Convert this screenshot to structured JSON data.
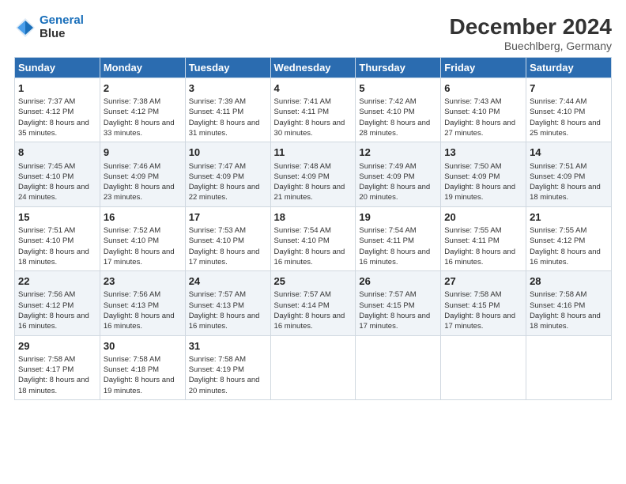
{
  "header": {
    "logo_line1": "General",
    "logo_line2": "Blue",
    "title": "December 2024",
    "subtitle": "Buechlberg, Germany"
  },
  "days_of_week": [
    "Sunday",
    "Monday",
    "Tuesday",
    "Wednesday",
    "Thursday",
    "Friday",
    "Saturday"
  ],
  "weeks": [
    [
      {
        "day": "1",
        "sunrise": "Sunrise: 7:37 AM",
        "sunset": "Sunset: 4:12 PM",
        "daylight": "Daylight: 8 hours and 35 minutes."
      },
      {
        "day": "2",
        "sunrise": "Sunrise: 7:38 AM",
        "sunset": "Sunset: 4:12 PM",
        "daylight": "Daylight: 8 hours and 33 minutes."
      },
      {
        "day": "3",
        "sunrise": "Sunrise: 7:39 AM",
        "sunset": "Sunset: 4:11 PM",
        "daylight": "Daylight: 8 hours and 31 minutes."
      },
      {
        "day": "4",
        "sunrise": "Sunrise: 7:41 AM",
        "sunset": "Sunset: 4:11 PM",
        "daylight": "Daylight: 8 hours and 30 minutes."
      },
      {
        "day": "5",
        "sunrise": "Sunrise: 7:42 AM",
        "sunset": "Sunset: 4:10 PM",
        "daylight": "Daylight: 8 hours and 28 minutes."
      },
      {
        "day": "6",
        "sunrise": "Sunrise: 7:43 AM",
        "sunset": "Sunset: 4:10 PM",
        "daylight": "Daylight: 8 hours and 27 minutes."
      },
      {
        "day": "7",
        "sunrise": "Sunrise: 7:44 AM",
        "sunset": "Sunset: 4:10 PM",
        "daylight": "Daylight: 8 hours and 25 minutes."
      }
    ],
    [
      {
        "day": "8",
        "sunrise": "Sunrise: 7:45 AM",
        "sunset": "Sunset: 4:10 PM",
        "daylight": "Daylight: 8 hours and 24 minutes."
      },
      {
        "day": "9",
        "sunrise": "Sunrise: 7:46 AM",
        "sunset": "Sunset: 4:09 PM",
        "daylight": "Daylight: 8 hours and 23 minutes."
      },
      {
        "day": "10",
        "sunrise": "Sunrise: 7:47 AM",
        "sunset": "Sunset: 4:09 PM",
        "daylight": "Daylight: 8 hours and 22 minutes."
      },
      {
        "day": "11",
        "sunrise": "Sunrise: 7:48 AM",
        "sunset": "Sunset: 4:09 PM",
        "daylight": "Daylight: 8 hours and 21 minutes."
      },
      {
        "day": "12",
        "sunrise": "Sunrise: 7:49 AM",
        "sunset": "Sunset: 4:09 PM",
        "daylight": "Daylight: 8 hours and 20 minutes."
      },
      {
        "day": "13",
        "sunrise": "Sunrise: 7:50 AM",
        "sunset": "Sunset: 4:09 PM",
        "daylight": "Daylight: 8 hours and 19 minutes."
      },
      {
        "day": "14",
        "sunrise": "Sunrise: 7:51 AM",
        "sunset": "Sunset: 4:09 PM",
        "daylight": "Daylight: 8 hours and 18 minutes."
      }
    ],
    [
      {
        "day": "15",
        "sunrise": "Sunrise: 7:51 AM",
        "sunset": "Sunset: 4:10 PM",
        "daylight": "Daylight: 8 hours and 18 minutes."
      },
      {
        "day": "16",
        "sunrise": "Sunrise: 7:52 AM",
        "sunset": "Sunset: 4:10 PM",
        "daylight": "Daylight: 8 hours and 17 minutes."
      },
      {
        "day": "17",
        "sunrise": "Sunrise: 7:53 AM",
        "sunset": "Sunset: 4:10 PM",
        "daylight": "Daylight: 8 hours and 17 minutes."
      },
      {
        "day": "18",
        "sunrise": "Sunrise: 7:54 AM",
        "sunset": "Sunset: 4:10 PM",
        "daylight": "Daylight: 8 hours and 16 minutes."
      },
      {
        "day": "19",
        "sunrise": "Sunrise: 7:54 AM",
        "sunset": "Sunset: 4:11 PM",
        "daylight": "Daylight: 8 hours and 16 minutes."
      },
      {
        "day": "20",
        "sunrise": "Sunrise: 7:55 AM",
        "sunset": "Sunset: 4:11 PM",
        "daylight": "Daylight: 8 hours and 16 minutes."
      },
      {
        "day": "21",
        "sunrise": "Sunrise: 7:55 AM",
        "sunset": "Sunset: 4:12 PM",
        "daylight": "Daylight: 8 hours and 16 minutes."
      }
    ],
    [
      {
        "day": "22",
        "sunrise": "Sunrise: 7:56 AM",
        "sunset": "Sunset: 4:12 PM",
        "daylight": "Daylight: 8 hours and 16 minutes."
      },
      {
        "day": "23",
        "sunrise": "Sunrise: 7:56 AM",
        "sunset": "Sunset: 4:13 PM",
        "daylight": "Daylight: 8 hours and 16 minutes."
      },
      {
        "day": "24",
        "sunrise": "Sunrise: 7:57 AM",
        "sunset": "Sunset: 4:13 PM",
        "daylight": "Daylight: 8 hours and 16 minutes."
      },
      {
        "day": "25",
        "sunrise": "Sunrise: 7:57 AM",
        "sunset": "Sunset: 4:14 PM",
        "daylight": "Daylight: 8 hours and 16 minutes."
      },
      {
        "day": "26",
        "sunrise": "Sunrise: 7:57 AM",
        "sunset": "Sunset: 4:15 PM",
        "daylight": "Daylight: 8 hours and 17 minutes."
      },
      {
        "day": "27",
        "sunrise": "Sunrise: 7:58 AM",
        "sunset": "Sunset: 4:15 PM",
        "daylight": "Daylight: 8 hours and 17 minutes."
      },
      {
        "day": "28",
        "sunrise": "Sunrise: 7:58 AM",
        "sunset": "Sunset: 4:16 PM",
        "daylight": "Daylight: 8 hours and 18 minutes."
      }
    ],
    [
      {
        "day": "29",
        "sunrise": "Sunrise: 7:58 AM",
        "sunset": "Sunset: 4:17 PM",
        "daylight": "Daylight: 8 hours and 18 minutes."
      },
      {
        "day": "30",
        "sunrise": "Sunrise: 7:58 AM",
        "sunset": "Sunset: 4:18 PM",
        "daylight": "Daylight: 8 hours and 19 minutes."
      },
      {
        "day": "31",
        "sunrise": "Sunrise: 7:58 AM",
        "sunset": "Sunset: 4:19 PM",
        "daylight": "Daylight: 8 hours and 20 minutes."
      },
      null,
      null,
      null,
      null
    ]
  ]
}
